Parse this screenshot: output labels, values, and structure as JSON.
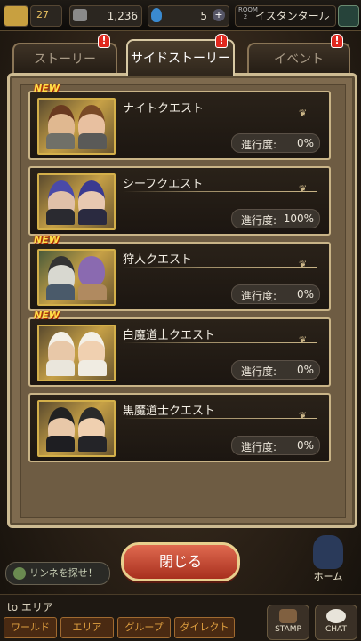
{
  "topbar": {
    "level_badge": "27",
    "gil": "1,236",
    "gems": "5",
    "room_label": "ROOM\n2",
    "room_name": "イスタンタール"
  },
  "tabs": [
    {
      "label": "ストーリー",
      "active": false,
      "alert": "!"
    },
    {
      "label": "サイドストーリー",
      "active": true,
      "alert": "!"
    },
    {
      "label": "イベント",
      "active": false,
      "alert": "!"
    }
  ],
  "quests": [
    {
      "title": "ナイトクエスト",
      "progress_label": "進行度:",
      "progress_value": "0%",
      "is_new": true,
      "new_label": "NEW"
    },
    {
      "title": "シーフクエスト",
      "progress_label": "進行度:",
      "progress_value": "100%",
      "is_new": false,
      "new_label": ""
    },
    {
      "title": "狩人クエスト",
      "progress_label": "進行度:",
      "progress_value": "0%",
      "is_new": true,
      "new_label": "NEW"
    },
    {
      "title": "白魔道士クエスト",
      "progress_label": "進行度:",
      "progress_value": "0%",
      "is_new": true,
      "new_label": "NEW"
    },
    {
      "title": "黒魔道士クエスト",
      "progress_label": "進行度:",
      "progress_value": "0%",
      "is_new": false,
      "new_label": ""
    }
  ],
  "close_button": "閉じる",
  "find_button": "リンネを探せ！",
  "home_label": "ホーム",
  "chat": {
    "area_label": "to エリア",
    "tabs": [
      "ワールド",
      "エリア",
      "グループ",
      "ダイレクト"
    ],
    "stamp": "STAMP",
    "chat": "CHAT"
  },
  "colors": {
    "accent_gold": "#c9b487",
    "alert_red": "#e0281e",
    "close_button": "#c04a32"
  }
}
